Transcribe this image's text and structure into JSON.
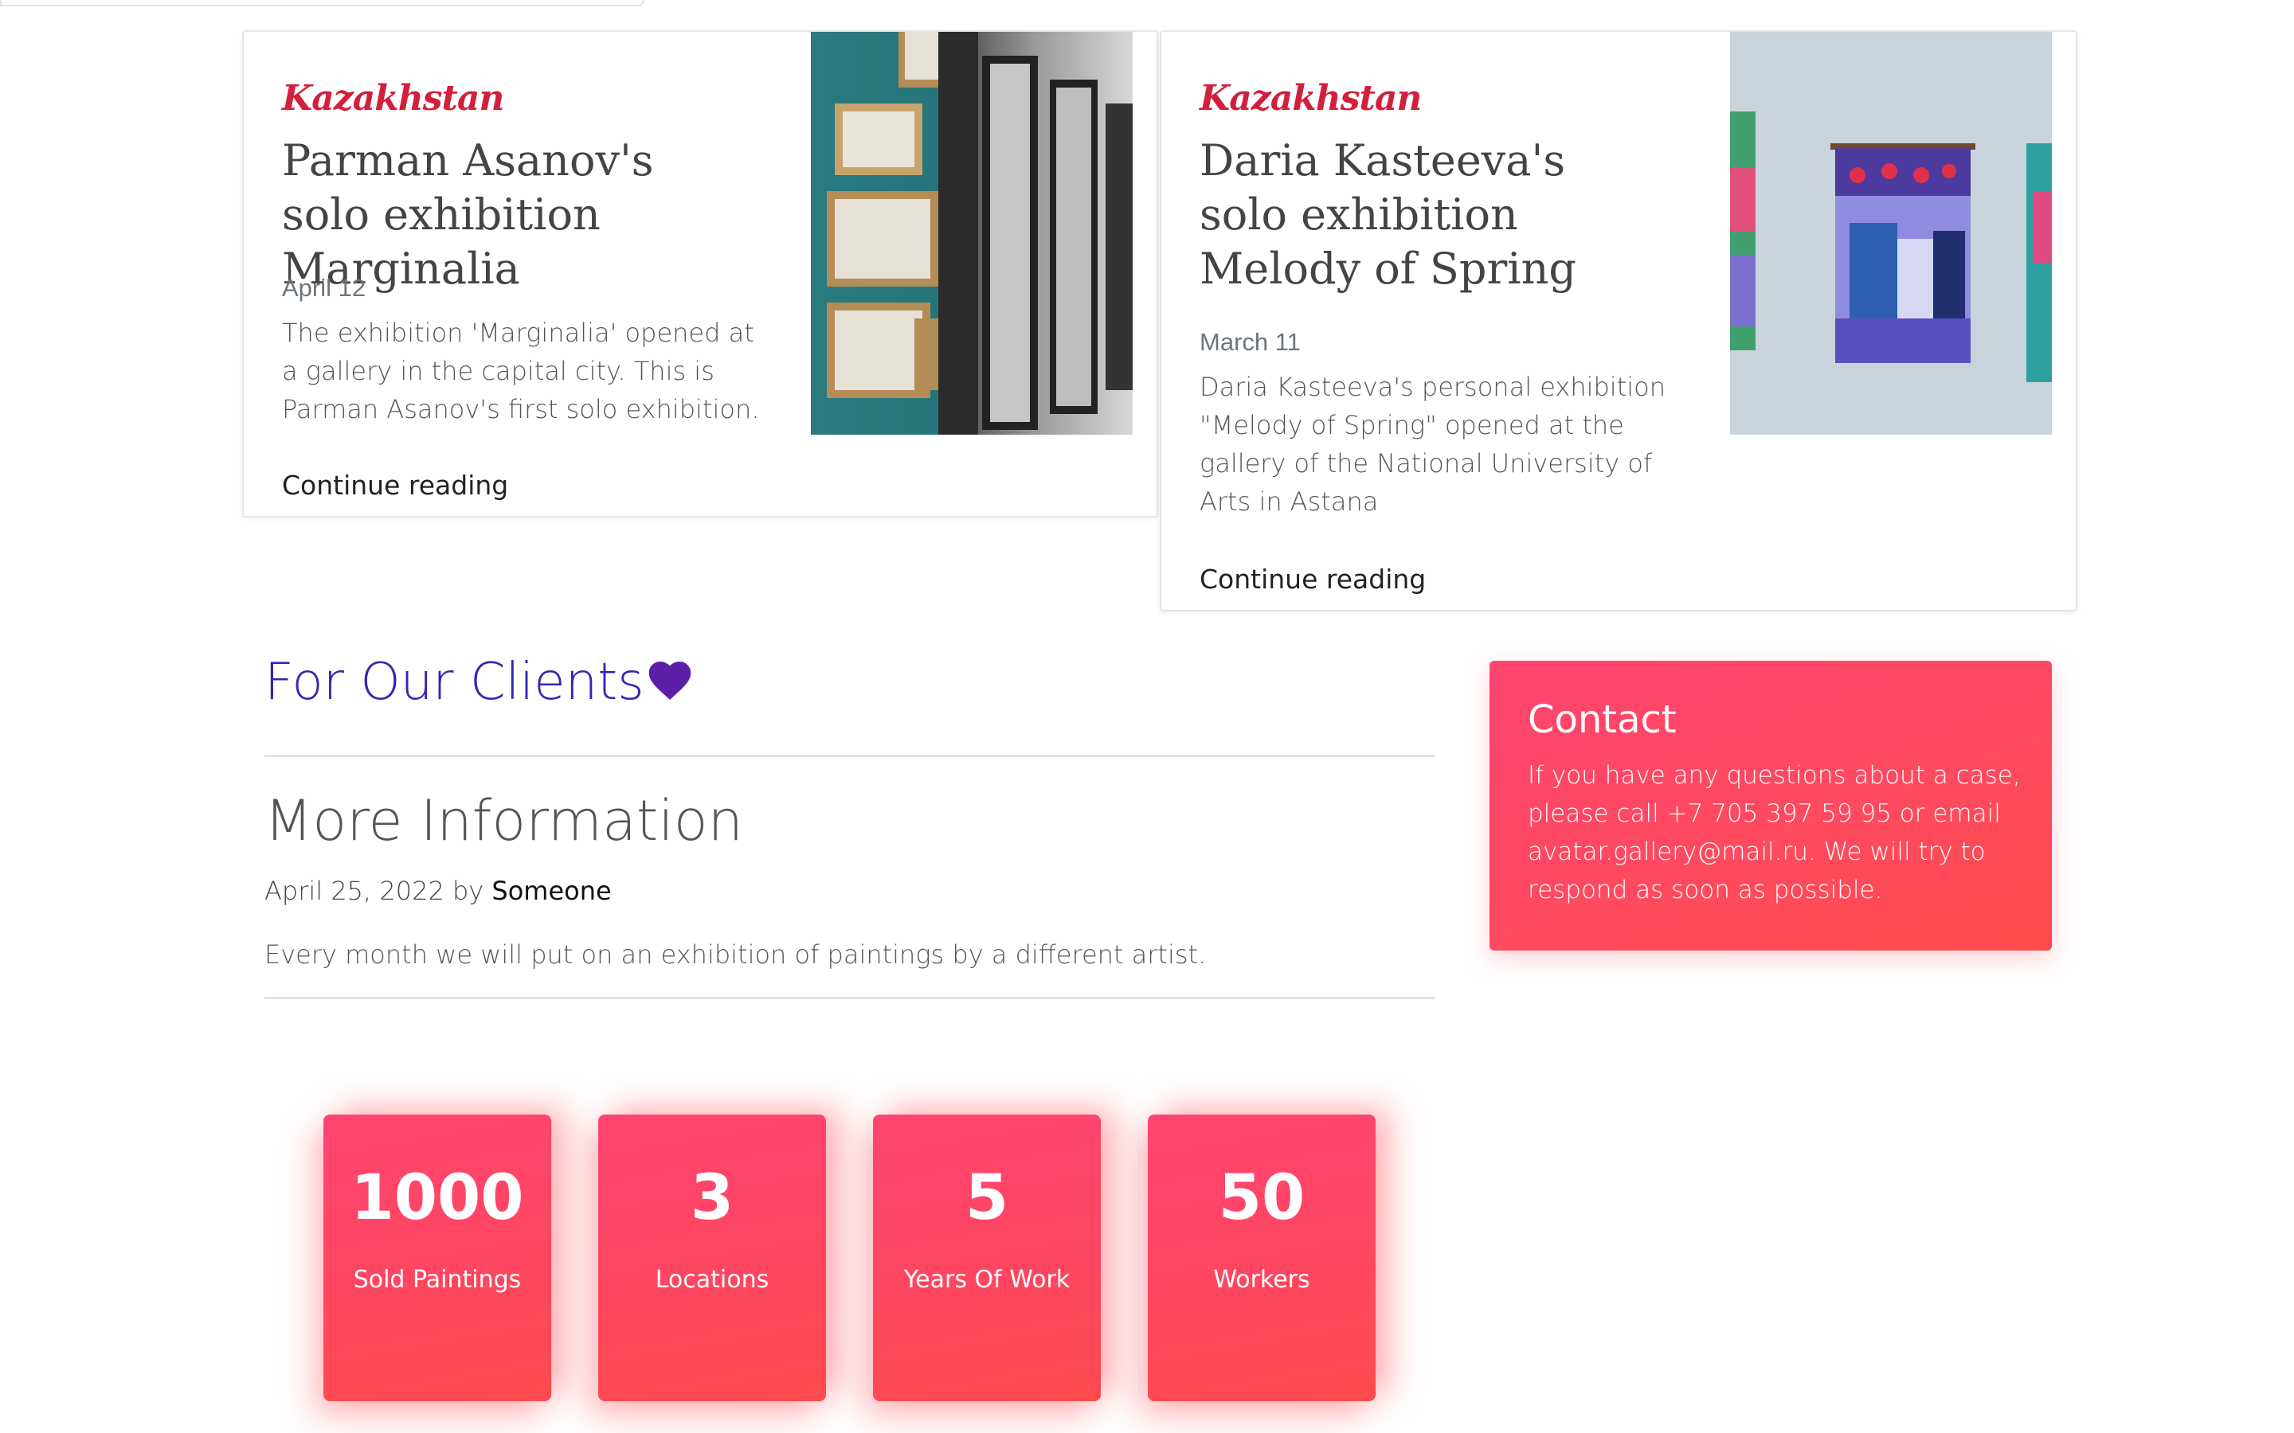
{
  "cards": [
    {
      "tag": "Kazakhstan",
      "title": "Parman Asanov's solo exhibition Marginalia",
      "date": "April 12",
      "text": "The exhibition 'Marginalia' opened at a gallery in the capital city. This is Parman Asanov's first solo exhibition.",
      "link": "Continue reading"
    },
    {
      "tag": "Kazakhstan",
      "title": "Daria Kasteeva's solo exhibition Melody of Spring",
      "date": "March 11",
      "text": "Daria Kasteeva's personal exhibition \"Melody of Spring\" opened at the gallery of the National University of Arts in Astana",
      "link": "Continue reading"
    }
  ],
  "clients": {
    "title": "For Our Clients",
    "post_title": "More Information",
    "post_date": "April 25, 2022",
    "by": "by",
    "author": "Someone",
    "description": "Every month we will put on an exhibition of paintings by a different artist."
  },
  "contact": {
    "title": "Contact",
    "text": "If you have any questions about a case, please call +7 705 397 59 95 or email avatar.gallery@mail.ru. We will try to respond as soon as possible."
  },
  "stats": [
    {
      "number": "1000",
      "label": "Sold Paintings"
    },
    {
      "number": "3",
      "label": "Locations"
    },
    {
      "number": "5",
      "label": "Years Of Work"
    },
    {
      "number": "50",
      "label": "Workers"
    }
  ],
  "colors": {
    "tag": "#d21f3c",
    "clients_title": "#3325b4",
    "heart": "#5b1fa8",
    "accent_pink": "#ff4466"
  }
}
